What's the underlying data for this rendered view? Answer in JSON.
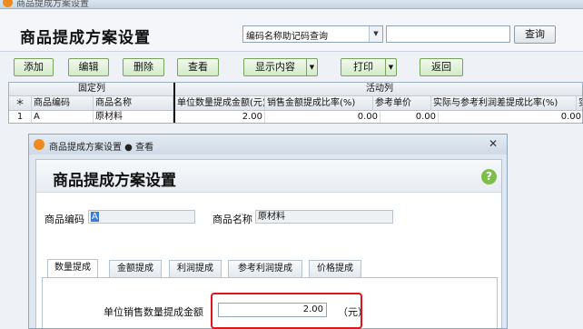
{
  "window": {
    "title": "商品提成方案设置"
  },
  "page": {
    "title": "商品提成方案设置"
  },
  "search": {
    "mode": "编码名称助记码查询",
    "query": "",
    "button": "查询"
  },
  "toolbar": {
    "add": "添加",
    "edit": "编辑",
    "delete": "删除",
    "view": "查看",
    "display": "显示内容",
    "print": "打印",
    "back": "返回"
  },
  "grid": {
    "group_fixed": "固定列",
    "group_active": "活动列",
    "columns": [
      "＊",
      "商品编码",
      "商品名称",
      "单位数量提成金额(元)",
      "销售金额提成比率(%)",
      "参考单价",
      "实际与参考利润差提成比率(%)",
      "实"
    ],
    "rows": [
      {
        "idx": "1",
        "code": "A",
        "name": "原材料",
        "unit_amt": "2.00",
        "sale_rate": "0.00",
        "ref_price": "0.00",
        "diff_rate": "0.00"
      }
    ]
  },
  "dialog": {
    "title": "商品提成方案设置 ● 查看",
    "heading": "商品提成方案设置",
    "help": "?",
    "code_label": "商品编码",
    "code_value": "A",
    "name_label": "商品名称",
    "name_value": "原材料",
    "tabs": [
      "数量提成",
      "金额提成",
      "利润提成",
      "参考利润提成",
      "价格提成"
    ],
    "active_tab": "数量提成",
    "field_label": "单位销售数量提成金额",
    "field_value": "2.00",
    "field_unit": "（元）"
  },
  "colors": {
    "highlight_border": "#e0141e",
    "button_green": "#d3ebc6",
    "help_green": "#7bbf4a"
  }
}
